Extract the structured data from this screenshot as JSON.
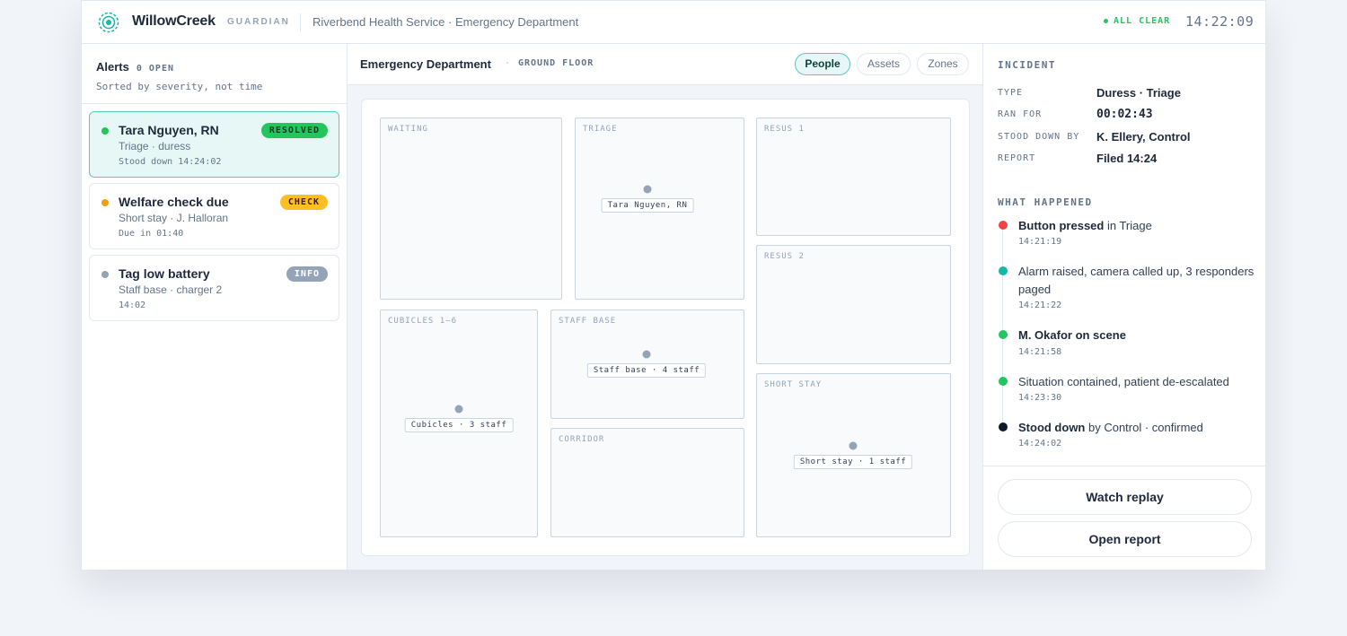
{
  "header": {
    "brand": "WillowCreek",
    "product": "GUARDIAN",
    "facility": "Riverbend Health Service · Emergency Department",
    "status": "ALL CLEAR",
    "clock": "14:22:09"
  },
  "alerts": {
    "title": "Alerts",
    "count": "0 OPEN",
    "subtitle": "Sorted by severity, not time",
    "items": [
      {
        "title": "Tara Nguyen, RN",
        "subtitle": "Triage · duress",
        "time": "Stood down 14:24:02",
        "badge": "RESOLVED",
        "dot_color": "#22c55e",
        "badge_bg": "#22c55e",
        "badge_fg": "#0b3b20"
      },
      {
        "title": "Welfare check due",
        "subtitle": "Short stay · J. Halloran",
        "time": "Due in 01:40",
        "badge": "CHECK",
        "dot_color": "#f59e0b",
        "badge_bg": "#fbbf24",
        "badge_fg": "#422006"
      },
      {
        "title": "Tag low battery",
        "subtitle": "Staff base · charger 2",
        "time": "14:02",
        "badge": "INFO",
        "dot_color": "#94a3b8",
        "badge_bg": "#94a3b8",
        "badge_fg": "#ffffff"
      }
    ]
  },
  "map": {
    "area": "Emergency Department",
    "separator": "·",
    "floor": "GROUND FLOOR",
    "tabs": [
      "People",
      "Assets",
      "Zones"
    ],
    "active_tab": "People",
    "zones": [
      "WAITING",
      "TRIAGE",
      "RESUS 1",
      "RESUS 2",
      "CUBICLES 1–6",
      "STAFF BASE",
      "CORRIDOR",
      "SHORT STAY"
    ],
    "markers": [
      "Tara Nguyen, RN",
      "Staff base · 4 staff",
      "Cubicles · 3 staff",
      "Short stay · 1 staff"
    ]
  },
  "incident": {
    "title": "INCIDENT",
    "fields": [
      {
        "key": "TYPE",
        "value": "Duress · Triage"
      },
      {
        "key": "RAN FOR",
        "value": "00:02:43"
      },
      {
        "key": "STOOD DOWN BY",
        "value": "K. Ellery, Control"
      },
      {
        "key": "REPORT",
        "value": "Filed 14:24"
      }
    ]
  },
  "timeline": {
    "title": "WHAT HAPPENED",
    "events": [
      {
        "bold": "Button pressed",
        "rest": " in Triage",
        "time": "14:21:19",
        "color": "#ef4444"
      },
      {
        "bold": "",
        "rest": "Alarm raised, camera called up, 3 responders paged",
        "time": "14:21:22",
        "color": "#14b8a6"
      },
      {
        "bold": "M. Okafor on scene",
        "rest": "",
        "time": "14:21:58",
        "color": "#22c55e"
      },
      {
        "bold": "",
        "rest": "Situation contained, patient de-escalated",
        "time": "14:23:30",
        "color": "#22c55e"
      },
      {
        "bold": "Stood down",
        "rest": " by Control · confirmed",
        "time": "14:24:02",
        "color": "#0f172a"
      }
    ]
  },
  "actions": {
    "replay": "Watch replay",
    "report": "Open report"
  }
}
